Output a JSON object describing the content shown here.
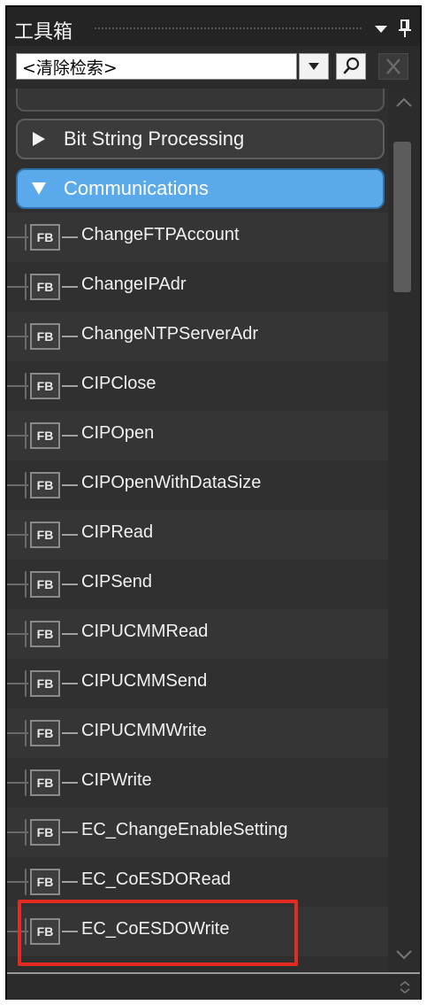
{
  "panel": {
    "title": "工具箱"
  },
  "search": {
    "value": "<清除检索>"
  },
  "categories": {
    "collapsed": {
      "label": "Bit String Processing"
    },
    "expanded": {
      "label": "Communications"
    }
  },
  "items": [
    {
      "badge": "FB",
      "name": "ChangeFTPAccount"
    },
    {
      "badge": "FB",
      "name": "ChangeIPAdr"
    },
    {
      "badge": "FB",
      "name": "ChangeNTPServerAdr"
    },
    {
      "badge": "FB",
      "name": "CIPClose"
    },
    {
      "badge": "FB",
      "name": "CIPOpen"
    },
    {
      "badge": "FB",
      "name": "CIPOpenWithDataSize"
    },
    {
      "badge": "FB",
      "name": "CIPRead"
    },
    {
      "badge": "FB",
      "name": "CIPSend"
    },
    {
      "badge": "FB",
      "name": "CIPUCMMRead"
    },
    {
      "badge": "FB",
      "name": "CIPUCMMSend"
    },
    {
      "badge": "FB",
      "name": "CIPUCMMWrite"
    },
    {
      "badge": "FB",
      "name": "CIPWrite"
    },
    {
      "badge": "FB",
      "name": "EC_ChangeEnableSetting"
    },
    {
      "badge": "FB",
      "name": "EC_CoESDORead"
    },
    {
      "badge": "FB",
      "name": "EC_CoESDOWrite"
    }
  ],
  "colors": {
    "panel_bg": "#2b2b2b",
    "expanded_category": "#5aa9ea",
    "highlight_box": "#e32b22"
  },
  "icons": {
    "title_dropdown": "dropdown-arrow-icon",
    "title_pin": "pin-icon",
    "search_dropdown": "dropdown-arrow-icon",
    "search": "magnifier-icon",
    "clear": "close-icon",
    "collapsed_category": "triangle-right-icon",
    "expanded_category": "triangle-down-icon"
  }
}
